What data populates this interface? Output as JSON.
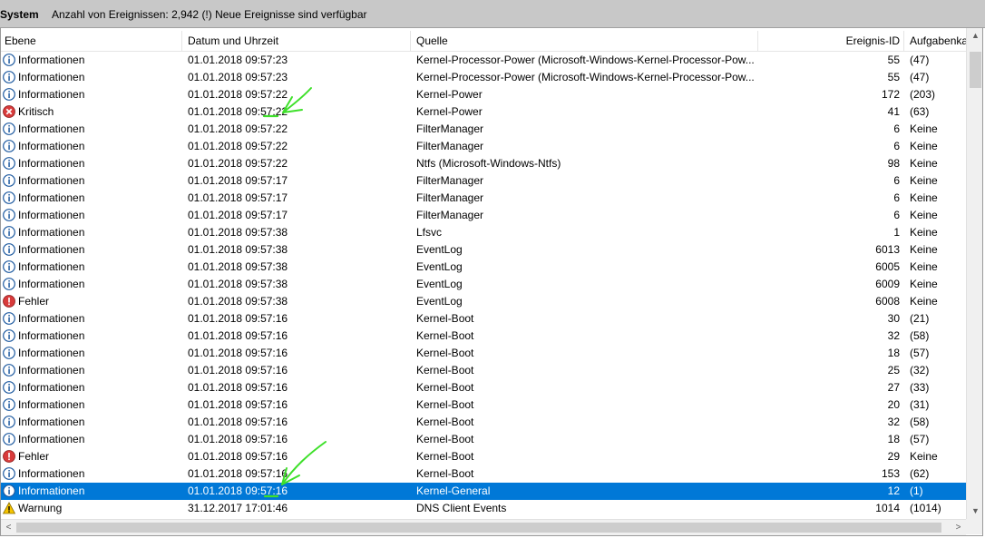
{
  "titlebar": {
    "title": "System",
    "info": "Anzahl von Ereignissen: 2,942 (!) Neue Ereignisse sind verfügbar"
  },
  "columns": [
    "Ebene",
    "Datum und Uhrzeit",
    "Quelle",
    "Ereignis-ID",
    "Aufgabenka"
  ],
  "rows": [
    {
      "level": "Informationen",
      "icon": "info-icon",
      "date": "01.01.2018 09:57:23",
      "source": "Kernel-Processor-Power (Microsoft-Windows-Kernel-Processor-Pow...",
      "id": "55",
      "task": "(47)"
    },
    {
      "level": "Informationen",
      "icon": "info-icon",
      "date": "01.01.2018 09:57:23",
      "source": "Kernel-Processor-Power (Microsoft-Windows-Kernel-Processor-Pow...",
      "id": "55",
      "task": "(47)"
    },
    {
      "level": "Informationen",
      "icon": "info-icon",
      "date": "01.01.2018 09:57:22",
      "source": "Kernel-Power",
      "id": "172",
      "task": "(203)"
    },
    {
      "level": "Kritisch",
      "icon": "critical-icon",
      "date": "01.01.2018 09:57:22",
      "source": "Kernel-Power",
      "id": "41",
      "task": "(63)"
    },
    {
      "level": "Informationen",
      "icon": "info-icon",
      "date": "01.01.2018 09:57:22",
      "source": "FilterManager",
      "id": "6",
      "task": "Keine"
    },
    {
      "level": "Informationen",
      "icon": "info-icon",
      "date": "01.01.2018 09:57:22",
      "source": "FilterManager",
      "id": "6",
      "task": "Keine"
    },
    {
      "level": "Informationen",
      "icon": "info-icon",
      "date": "01.01.2018 09:57:22",
      "source": "Ntfs (Microsoft-Windows-Ntfs)",
      "id": "98",
      "task": "Keine"
    },
    {
      "level": "Informationen",
      "icon": "info-icon",
      "date": "01.01.2018 09:57:17",
      "source": "FilterManager",
      "id": "6",
      "task": "Keine"
    },
    {
      "level": "Informationen",
      "icon": "info-icon",
      "date": "01.01.2018 09:57:17",
      "source": "FilterManager",
      "id": "6",
      "task": "Keine"
    },
    {
      "level": "Informationen",
      "icon": "info-icon",
      "date": "01.01.2018 09:57:17",
      "source": "FilterManager",
      "id": "6",
      "task": "Keine"
    },
    {
      "level": "Informationen",
      "icon": "info-icon",
      "date": "01.01.2018 09:57:38",
      "source": "Lfsvc",
      "id": "1",
      "task": "Keine"
    },
    {
      "level": "Informationen",
      "icon": "info-icon",
      "date": "01.01.2018 09:57:38",
      "source": "EventLog",
      "id": "6013",
      "task": "Keine"
    },
    {
      "level": "Informationen",
      "icon": "info-icon",
      "date": "01.01.2018 09:57:38",
      "source": "EventLog",
      "id": "6005",
      "task": "Keine"
    },
    {
      "level": "Informationen",
      "icon": "info-icon",
      "date": "01.01.2018 09:57:38",
      "source": "EventLog",
      "id": "6009",
      "task": "Keine"
    },
    {
      "level": "Fehler",
      "icon": "error-icon",
      "date": "01.01.2018 09:57:38",
      "source": "EventLog",
      "id": "6008",
      "task": "Keine"
    },
    {
      "level": "Informationen",
      "icon": "info-icon",
      "date": "01.01.2018 09:57:16",
      "source": "Kernel-Boot",
      "id": "30",
      "task": "(21)"
    },
    {
      "level": "Informationen",
      "icon": "info-icon",
      "date": "01.01.2018 09:57:16",
      "source": "Kernel-Boot",
      "id": "32",
      "task": "(58)"
    },
    {
      "level": "Informationen",
      "icon": "info-icon",
      "date": "01.01.2018 09:57:16",
      "source": "Kernel-Boot",
      "id": "18",
      "task": "(57)"
    },
    {
      "level": "Informationen",
      "icon": "info-icon",
      "date": "01.01.2018 09:57:16",
      "source": "Kernel-Boot",
      "id": "25",
      "task": "(32)"
    },
    {
      "level": "Informationen",
      "icon": "info-icon",
      "date": "01.01.2018 09:57:16",
      "source": "Kernel-Boot",
      "id": "27",
      "task": "(33)"
    },
    {
      "level": "Informationen",
      "icon": "info-icon",
      "date": "01.01.2018 09:57:16",
      "source": "Kernel-Boot",
      "id": "20",
      "task": "(31)"
    },
    {
      "level": "Informationen",
      "icon": "info-icon",
      "date": "01.01.2018 09:57:16",
      "source": "Kernel-Boot",
      "id": "32",
      "task": "(58)"
    },
    {
      "level": "Informationen",
      "icon": "info-icon",
      "date": "01.01.2018 09:57:16",
      "source": "Kernel-Boot",
      "id": "18",
      "task": "(57)"
    },
    {
      "level": "Fehler",
      "icon": "error-icon",
      "date": "01.01.2018 09:57:16",
      "source": "Kernel-Boot",
      "id": "29",
      "task": "Keine"
    },
    {
      "level": "Informationen",
      "icon": "info-icon",
      "date": "01.01.2018 09:57:16",
      "source": "Kernel-Boot",
      "id": "153",
      "task": "(62)"
    },
    {
      "level": "Informationen",
      "icon": "info-icon",
      "date": "01.01.2018 09:57:16",
      "source": "Kernel-General",
      "id": "12",
      "task": "(1)",
      "selected": true
    },
    {
      "level": "Warnung",
      "icon": "warning-icon",
      "date": "31.12.2017 17:01:46",
      "source": "DNS Client Events",
      "id": "1014",
      "task": "(1014)"
    }
  ],
  "scrollbars": {
    "up_arrow": "▲",
    "down_arrow": "▼",
    "left_arrow": "<",
    "right_arrow": ">"
  },
  "colors": {
    "selection": "#0078d7",
    "annotation": "#3ee02a",
    "info": "#1e5aa0",
    "error": "#d83b3b",
    "warning": "#f5c400"
  }
}
